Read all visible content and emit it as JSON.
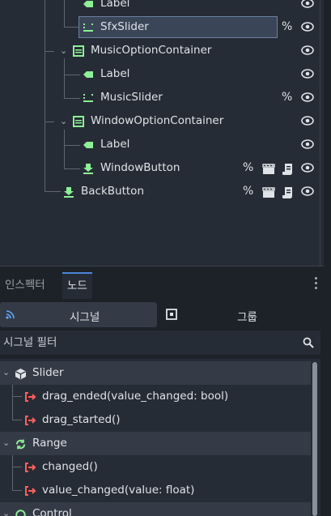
{
  "scene_tree": {
    "rows": [
      {
        "label": "Label",
        "icon": "label-icon"
      },
      {
        "label": "SfxSlider",
        "icon": "hslider-icon",
        "extra": "%"
      },
      {
        "label": "MusicOptionContainer",
        "icon": "vboxcontainer-icon"
      },
      {
        "label": "Label",
        "icon": "label-icon"
      },
      {
        "label": "MusicSlider",
        "icon": "hslider-icon",
        "extra": "%"
      },
      {
        "label": "WindowOptionContainer",
        "icon": "vboxcontainer-icon"
      },
      {
        "label": "Label",
        "icon": "label-icon"
      },
      {
        "label": "WindowButton",
        "icon": "button-icon",
        "extra": "%"
      },
      {
        "label": "BackButton",
        "icon": "button-icon",
        "extra": "%"
      }
    ]
  },
  "dock": {
    "tabs": [
      {
        "label": "인스펙터"
      },
      {
        "label": "노드"
      }
    ],
    "signals_label": "시그널",
    "groups_label": "그룹",
    "filter_placeholder": "시그널 필터"
  },
  "signals": {
    "items": [
      {
        "label": "Slider",
        "kind": "class"
      },
      {
        "label": "drag_ended(value_changed: bool)",
        "kind": "signal"
      },
      {
        "label": "drag_started()",
        "kind": "signal"
      },
      {
        "label": "Range",
        "kind": "class"
      },
      {
        "label": "changed()",
        "kind": "signal"
      },
      {
        "label": "value_changed(value: float)",
        "kind": "signal"
      },
      {
        "label": "Control",
        "kind": "class"
      }
    ]
  },
  "colors": {
    "label_icon": "#8eef97",
    "container_icon": "#8eef97",
    "signal_icon": "#ff5f5f",
    "accent": "#4a86d6"
  }
}
